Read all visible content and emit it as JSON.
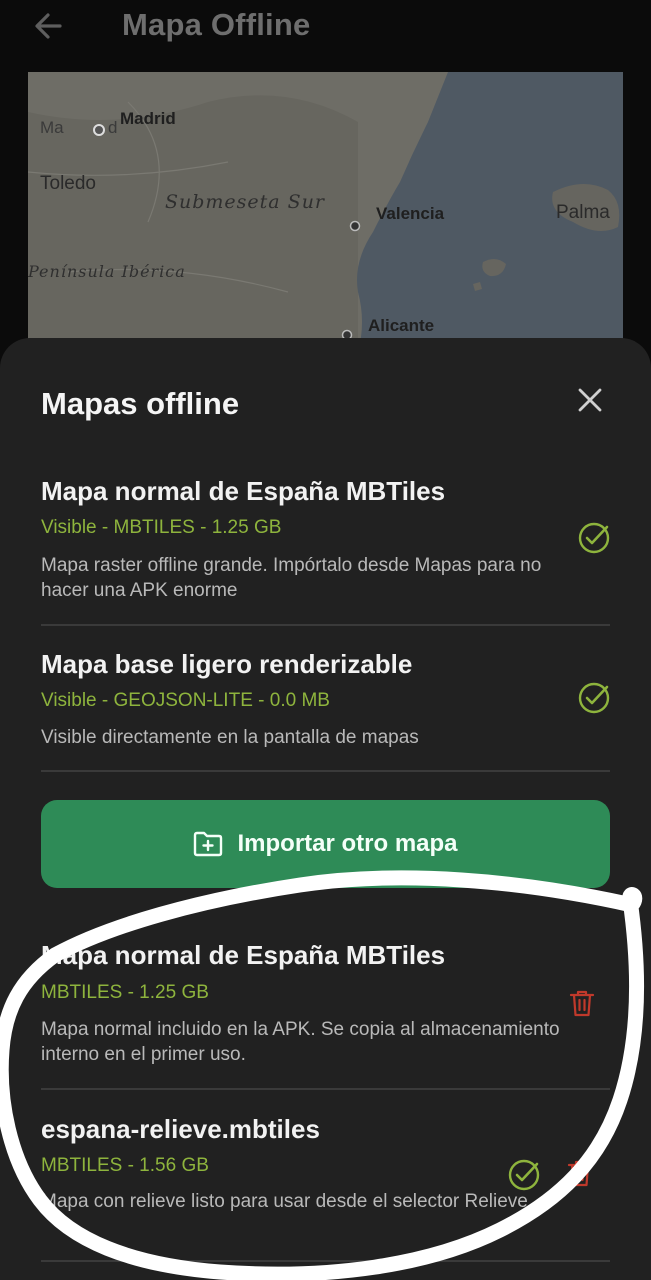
{
  "appbar": {
    "title": "Mapa Offline",
    "back_icon": "arrow-left-icon"
  },
  "map": {
    "labels": {
      "madrid": "Madrid",
      "madrid_base": "Ma",
      "madrid_tail": "d",
      "toledo": "Toledo",
      "submeseta": "Submeseta Sur",
      "valencia": "Valencia",
      "palma": "Palma",
      "peninsula": "Península Ibérica",
      "alicante": "Alicante"
    }
  },
  "sheet": {
    "title": "Mapas offline",
    "close_icon": "close-icon",
    "visible_items": [
      {
        "title": "Mapa normal de España MBTiles",
        "meta": "Visible - MBTILES - 1.25 GB",
        "description": "Mapa raster offline grande. Impórtalo desde Mapas para no hacer una APK enorme"
      },
      {
        "title": "Mapa base ligero renderizable",
        "meta": "Visible - GEOJSON-LITE - 0.0 MB",
        "description": "Visible directamente en la pantalla de mapas"
      }
    ],
    "import_button": {
      "label": "Importar otro mapa",
      "icon": "folder-plus-icon"
    },
    "stored_items": [
      {
        "title": "Mapa normal de España MBTiles",
        "meta": "MBTILES - 1.25 GB",
        "description": "Mapa normal incluido en la APK. Se copia al almacenamiento interno en el primer uso."
      },
      {
        "title": "espana-relieve.mbtiles",
        "meta": "MBTILES - 1.56 GB",
        "description": "Mapa con relieve listo para usar desde el selector Relieve."
      }
    ]
  },
  "colors": {
    "accent_green": "#2e8b57",
    "meta_text": "#8eb43d",
    "danger": "#c0392b",
    "background": "#212121"
  }
}
